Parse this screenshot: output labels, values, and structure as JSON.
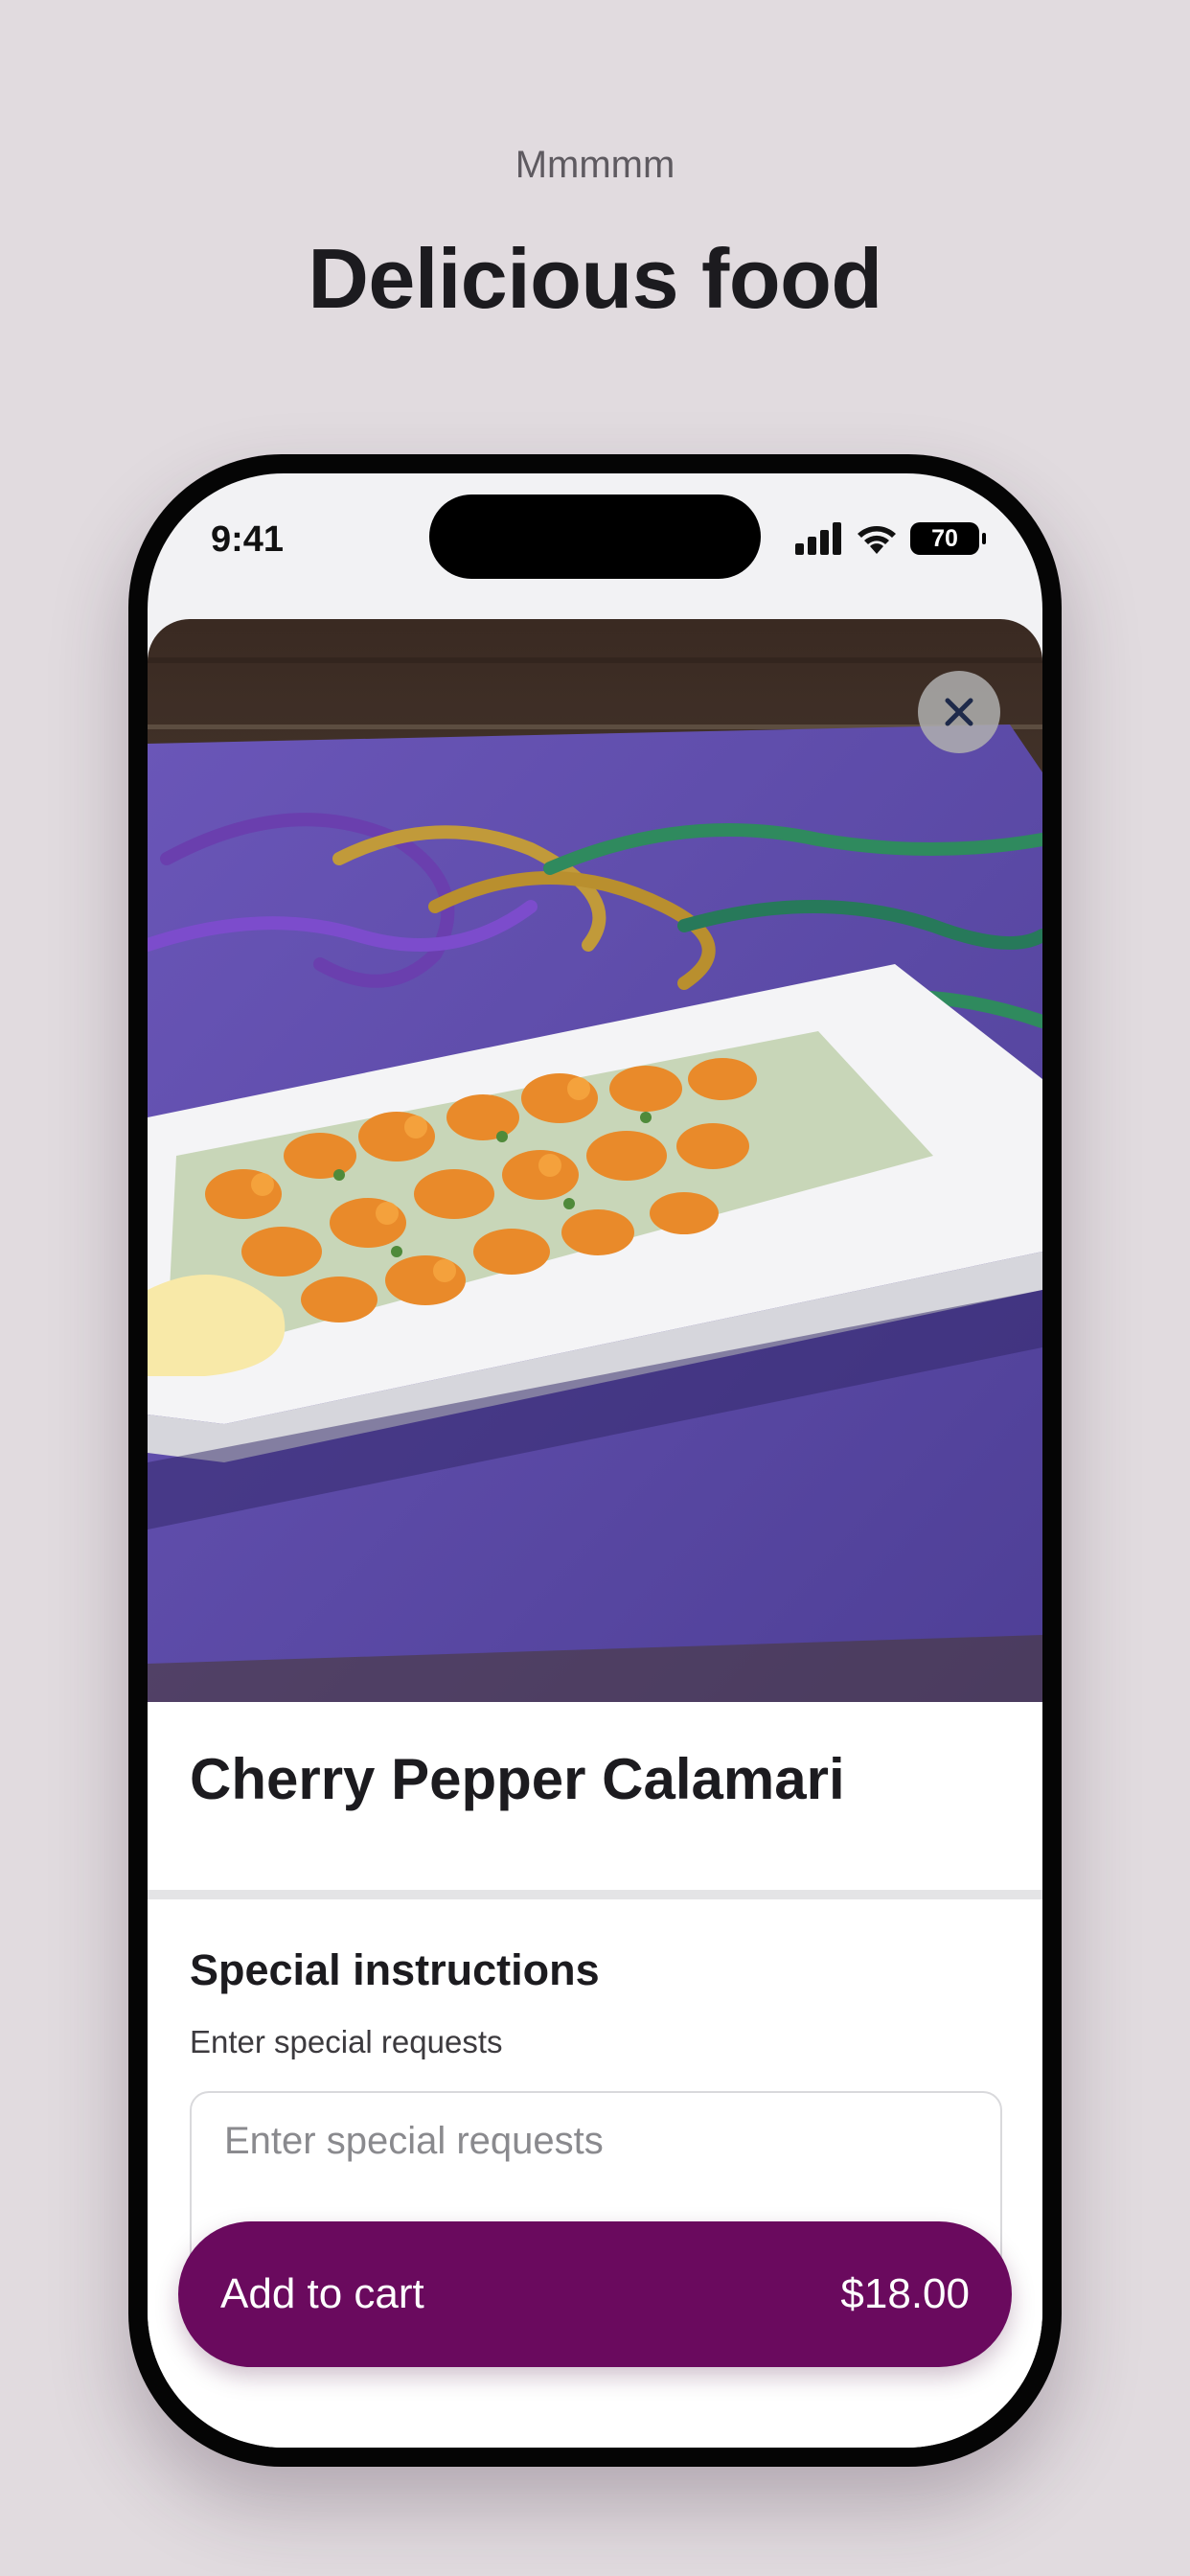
{
  "header": {
    "eyebrow": "Mmmmm",
    "headline": "Delicious food"
  },
  "status_bar": {
    "time": "9:41",
    "battery": "70",
    "icons": [
      "cellular-signal-icon",
      "wifi-icon",
      "battery-icon"
    ]
  },
  "item": {
    "image_icon": "food-photo",
    "title": "Cherry Pepper Calamari",
    "close_icon": "close-icon"
  },
  "instructions": {
    "title": "Special instructions",
    "subtitle": "Enter special requests",
    "placeholder": "Enter special requests",
    "value": ""
  },
  "cart": {
    "label": "Add to cart",
    "price": "$18.00"
  },
  "colors": {
    "background": "#e1dbdf",
    "accent": "#6a0a5e",
    "placemat": "#5b4aa6"
  }
}
